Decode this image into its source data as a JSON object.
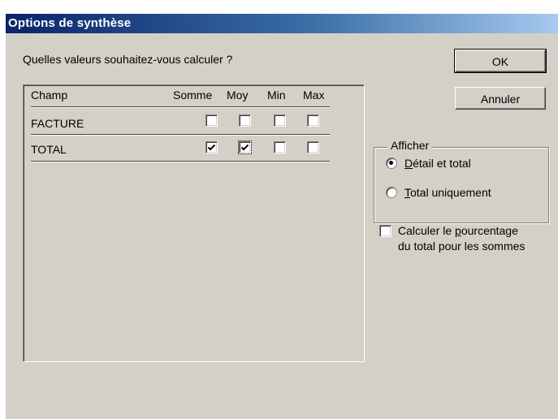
{
  "dialog": {
    "title": "Options de synthèse"
  },
  "prompt": "Quelles valeurs souhaitez-vous calculer ?",
  "table": {
    "headers": {
      "field": "Champ",
      "sum": "Somme",
      "avg": "Moy",
      "min": "Min",
      "max": "Max"
    },
    "rows": [
      {
        "field": "FACTURE",
        "sum": false,
        "avg": false,
        "min": false,
        "max": false
      },
      {
        "field": "TOTAL",
        "sum": true,
        "avg": true,
        "min": false,
        "max": false
      }
    ]
  },
  "buttons": {
    "ok": "OK",
    "cancel": "Annuler"
  },
  "display": {
    "label": "Afficher",
    "options": [
      {
        "prefix": "",
        "accel": "D",
        "rest": "étail et total",
        "selected": true
      },
      {
        "prefix": "",
        "accel": "T",
        "rest": "otal uniquement",
        "selected": false
      }
    ]
  },
  "percentage": {
    "line1_a": "Calculer le ",
    "line1_accel": "p",
    "line1_b": "ourcentage",
    "line2": "du total pour les sommes",
    "checked": false
  }
}
